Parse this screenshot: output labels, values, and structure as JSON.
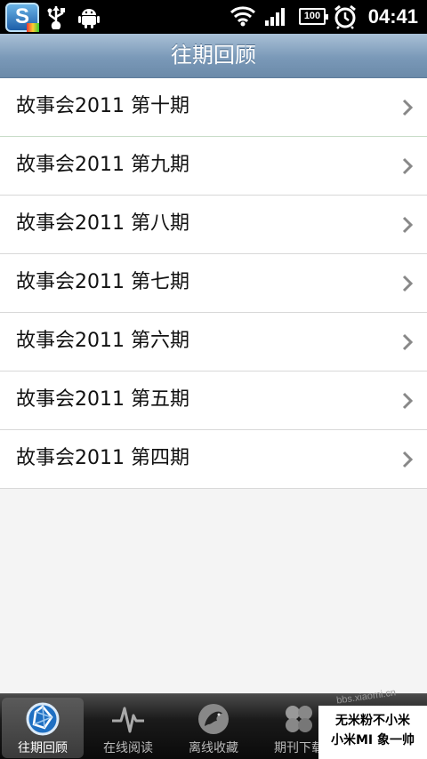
{
  "status_bar": {
    "app_letter": "S",
    "battery": "100",
    "time": "04:41",
    "icons": [
      "app-s-icon",
      "usb-icon",
      "android-icon",
      "wifi-icon",
      "signal-icon",
      "battery-icon",
      "alarm-icon"
    ]
  },
  "header": {
    "title": "往期回顾"
  },
  "list": {
    "items": [
      {
        "label": "故事会2011 第十期"
      },
      {
        "label": "故事会2011 第九期"
      },
      {
        "label": "故事会2011 第八期"
      },
      {
        "label": "故事会2011 第七期"
      },
      {
        "label": "故事会2011 第六期"
      },
      {
        "label": "故事会2011 第五期"
      },
      {
        "label": "故事会2011 第四期"
      }
    ]
  },
  "tabs": [
    {
      "label": "往期回顾",
      "icon": "aperture-icon",
      "active": true
    },
    {
      "label": "在线阅读",
      "icon": "pulse-icon",
      "active": false
    },
    {
      "label": "离线收藏",
      "icon": "dragon-icon",
      "active": false
    },
    {
      "label": "期刊下载",
      "icon": "hexagons-icon",
      "active": false
    }
  ],
  "watermark": {
    "line1": "无米粉不小米",
    "line2": "小米MI 象一帅",
    "url": "bbs.xiaomi.cn"
  },
  "colors": {
    "header": "#7a99b8",
    "status_bar": "#000000",
    "tab_bar": "#1a1a1a"
  }
}
